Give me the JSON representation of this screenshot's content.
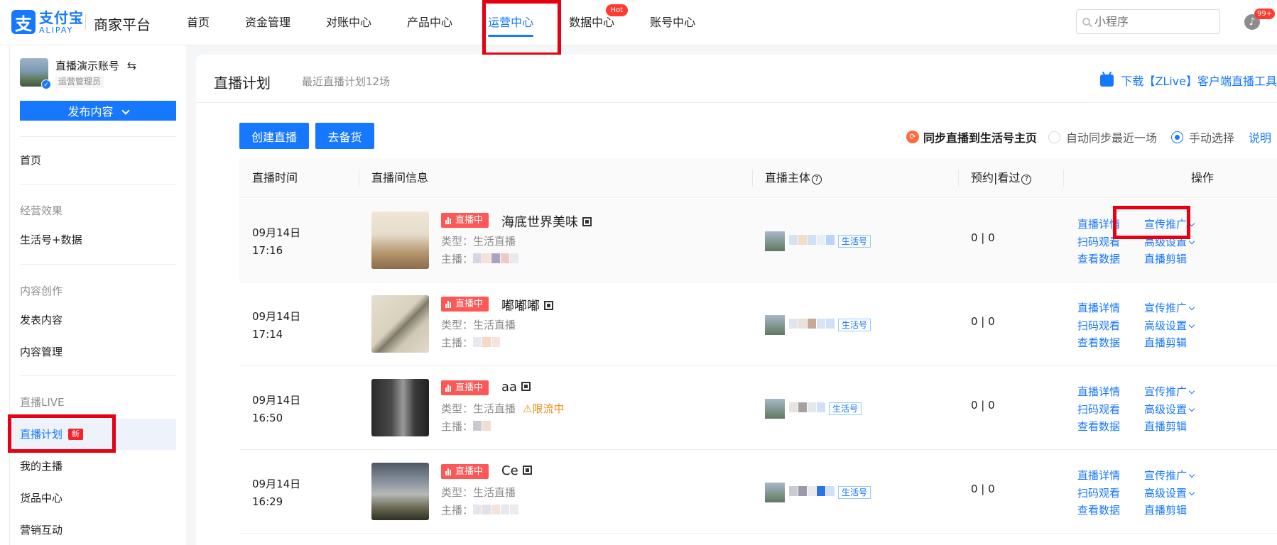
{
  "header": {
    "logo_glyph": "支",
    "logo_cn": "支付宝",
    "logo_en": "ALIPAY",
    "platform": "商家平台",
    "nav": [
      {
        "label": "首页"
      },
      {
        "label": "资金管理"
      },
      {
        "label": "对账中心"
      },
      {
        "label": "产品中心"
      },
      {
        "label": "运营中心",
        "active": true
      },
      {
        "label": "数据中心",
        "badge": "Hot"
      },
      {
        "label": "账号中心"
      }
    ],
    "search_placeholder": "小程序",
    "notification_count": "99+"
  },
  "sidebar": {
    "account_name": "直播演示账号",
    "account_switch_icon": "⇆",
    "account_role": "运营管理员",
    "publish_label": "发布内容",
    "items": [
      {
        "label": "首页"
      },
      {
        "group": "经营效果"
      },
      {
        "label": "生活号+数据"
      },
      {
        "group": "内容创作"
      },
      {
        "label": "发表内容"
      },
      {
        "label": "内容管理"
      },
      {
        "group": "直播LIVE"
      },
      {
        "label": "直播计划",
        "badge": "新",
        "active": true
      },
      {
        "label": "我的主播"
      },
      {
        "label": "货品中心"
      },
      {
        "label": "营销互动"
      }
    ]
  },
  "page": {
    "title": "直播计划",
    "subtitle": "最近直播计划12场",
    "download_link": "下载【ZLive】客户端直播工具",
    "create_button": "创建直播",
    "stock_button": "去备货",
    "sync_label": "同步直播到生活号主页",
    "sync_options": [
      "自动同步最近一场",
      "手动选择"
    ],
    "sync_selected": "手动选择",
    "help_link": "说明"
  },
  "table": {
    "columns": [
      "直播时间",
      "直播间信息",
      "直播主体",
      "预约|看过",
      "操作"
    ],
    "live_tag": "直播中",
    "type_prefix": "类型：",
    "host_prefix": "主播：",
    "subject_tag": "生活号",
    "actions_left": [
      "直播详情",
      "扫码观看",
      "查看数据"
    ],
    "actions_right": [
      "宣传推广",
      "高级设置",
      "直播剪辑"
    ],
    "rows": [
      {
        "date": "09月14日",
        "time": "17:16",
        "name": "海底世界美味",
        "type": "生活直播",
        "warning": "",
        "count": "0 | 0"
      },
      {
        "date": "09月14日",
        "time": "17:14",
        "name": "嘟嘟嘟",
        "type": "生活直播",
        "warning": "",
        "count": "0 | 0"
      },
      {
        "date": "09月14日",
        "time": "16:50",
        "name": "aa",
        "type": "生活直播",
        "warning": "⚠限流中",
        "count": "0 | 0"
      },
      {
        "date": "09月14日",
        "time": "16:29",
        "name": "Ce",
        "type": "生活直播",
        "warning": "",
        "count": "0 | 0"
      }
    ]
  },
  "colors": {
    "brand": "#1677ff",
    "live_tag": "#ff5656",
    "highlight_box": "#e60012",
    "warning": "#fa8c16"
  }
}
